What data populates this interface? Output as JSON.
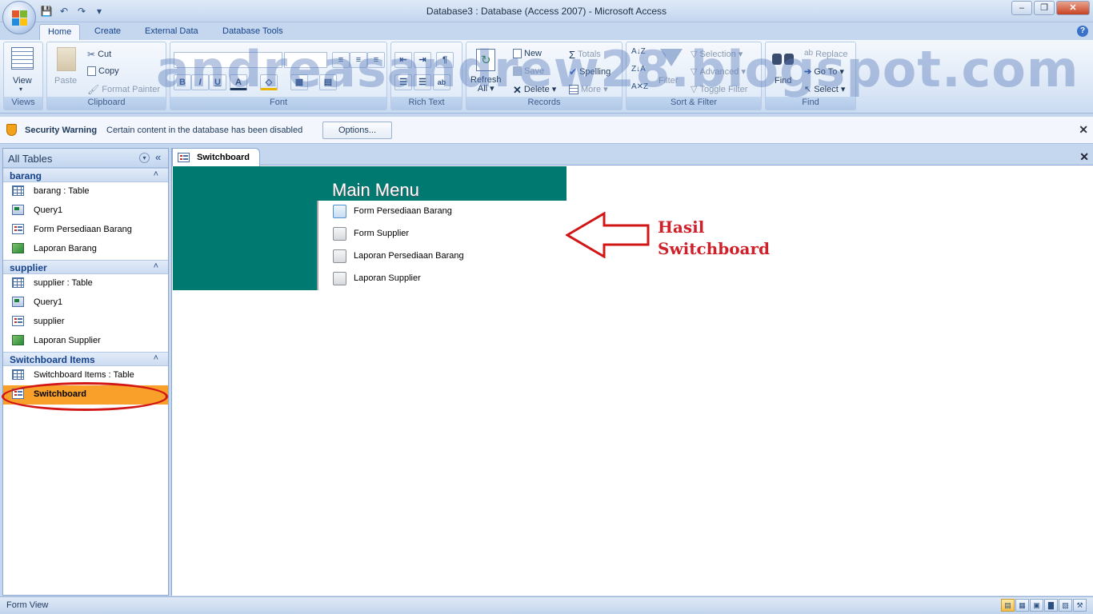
{
  "window": {
    "title": "Database3 : Database (Access 2007) - Microsoft Access"
  },
  "tabs": [
    {
      "label": "Home"
    },
    {
      "label": "Create"
    },
    {
      "label": "External Data"
    },
    {
      "label": "Database Tools"
    }
  ],
  "ribbon": {
    "views": {
      "view_label": "View",
      "group_label": "Views"
    },
    "clipboard": {
      "paste": "Paste",
      "cut": "Cut",
      "copy": "Copy",
      "format_painter": "Format Painter",
      "group_label": "Clipboard"
    },
    "font": {
      "group_label": "Font"
    },
    "rich_text": {
      "group_label": "Rich Text"
    },
    "records": {
      "refresh": "Refresh",
      "refresh2": "All",
      "new": "New",
      "save": "Save",
      "delete": "Delete",
      "totals": "Totals",
      "spelling": "Spelling",
      "more": "More",
      "group_label": "Records"
    },
    "sort_filter": {
      "filter": "Filter",
      "selection": "Selection",
      "advanced": "Advanced",
      "toggle_filter": "Toggle Filter",
      "group_label": "Sort & Filter"
    },
    "find": {
      "find": "Find",
      "replace": "Replace",
      "goto": "Go To",
      "select": "Select",
      "group_label": "Find"
    }
  },
  "watermark": "andreasandrew28.blogspot.com",
  "security": {
    "title": "Security Warning",
    "message": "Certain content in the database has been disabled",
    "options_label": "Options..."
  },
  "nav": {
    "title": "All Tables",
    "groups": [
      {
        "label": "barang",
        "items": [
          {
            "label": "barang : Table",
            "icon": "table-icon"
          },
          {
            "label": "Query1",
            "icon": "query-icon"
          },
          {
            "label": "Form Persediaan Barang",
            "icon": "form-icon"
          },
          {
            "label": "Laporan Barang",
            "icon": "report-icon"
          }
        ]
      },
      {
        "label": "supplier",
        "items": [
          {
            "label": "supplier : Table",
            "icon": "table-icon"
          },
          {
            "label": "Query1",
            "icon": "query-icon"
          },
          {
            "label": "supplier",
            "icon": "form-icon"
          },
          {
            "label": "Laporan Supplier",
            "icon": "report-icon"
          }
        ]
      },
      {
        "label": "Switchboard Items",
        "items": [
          {
            "label": "Switchboard Items : Table",
            "icon": "table-icon"
          },
          {
            "label": "Switchboard",
            "icon": "form-icon",
            "selected": true
          }
        ]
      }
    ]
  },
  "document": {
    "tab_label": "Switchboard",
    "switchboard": {
      "title": "Main Menu",
      "items": [
        {
          "label": "Form Persediaan Barang"
        },
        {
          "label": "Form Supplier"
        },
        {
          "label": "Laporan Persediaan Barang"
        },
        {
          "label": "Laporan Supplier"
        }
      ]
    },
    "annotation": {
      "line1": "Hasil",
      "line2": "Switchboard",
      "color": "#d0202a"
    }
  },
  "status": {
    "text": "Form View"
  },
  "colors": {
    "switchboard_header": "#007a70",
    "selected_item": "#f9a02b"
  }
}
